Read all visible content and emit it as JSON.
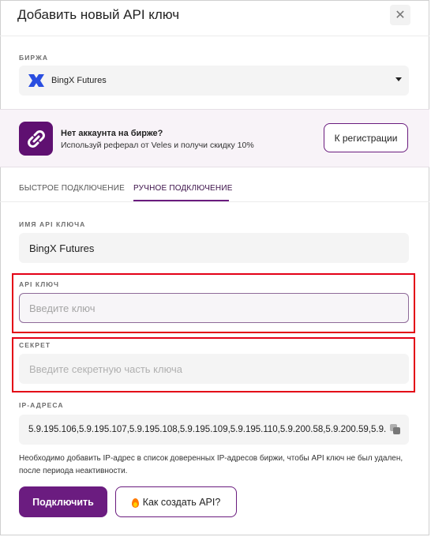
{
  "dialog": {
    "title": "Добавить новый API ключ",
    "close_icon": "close-icon"
  },
  "exchange": {
    "label": "БИРЖА",
    "selected": "BingX Futures",
    "logo_icon": "bingx-logo",
    "caret_icon": "chevron-down-icon"
  },
  "promo": {
    "icon": "link-icon",
    "title": "Нет аккаунта на бирже?",
    "subtitle": "Используй реферал от Veles и получи скидку 10%",
    "button_label": "К регистрации"
  },
  "tabs": [
    {
      "label": "БЫСТРОЕ ПОДКЛЮЧЕНИЕ",
      "active": false
    },
    {
      "label": "РУЧНОЕ ПОДКЛЮЧЕНИЕ",
      "active": true
    }
  ],
  "form": {
    "api_name": {
      "label": "ИМЯ API КЛЮЧА",
      "value": "BingX Futures"
    },
    "api_key": {
      "label": "API КЛЮЧ",
      "placeholder": "Введите ключ",
      "value": ""
    },
    "secret": {
      "label": "СЕКРЕТ",
      "placeholder": "Введите секретную часть ключа",
      "value": ""
    },
    "ip": {
      "label": "IP-АДРЕСА",
      "value": "5.9.195.106,5.9.195.107,5.9.195.108,5.9.195.109,5.9.195.110,5.9.200.58,5.9.200.59,5.9.",
      "copy_icon": "copy-icon"
    },
    "note": "Необходимо добавить IP-адрес в список доверенных IP-адресов биржи, чтобы API ключ не был удален, после периода неактивности."
  },
  "actions": {
    "connect_label": "Подключить",
    "howto_label": "Как создать API?",
    "howto_icon": "fire-icon"
  },
  "colors": {
    "accent": "#6b1c80",
    "highlight": "#e30016",
    "promo_bg": "#f8f3f8",
    "bingx_blue": "#2a4ee0"
  }
}
